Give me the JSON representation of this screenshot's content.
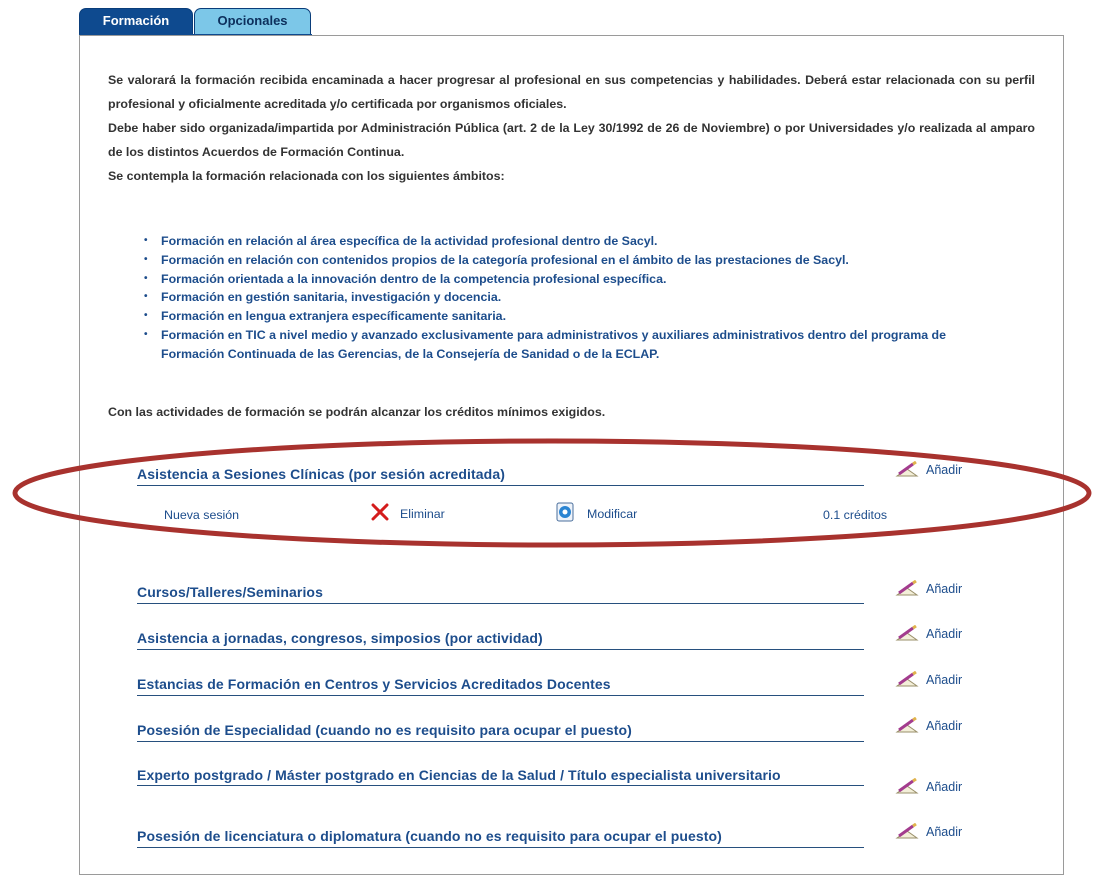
{
  "tabs": [
    {
      "label": "Formación",
      "active": true
    },
    {
      "label": "Opcionales",
      "active": false
    }
  ],
  "intro": {
    "paragraph1": "Se valorará la formación recibida encaminada a hacer progresar al profesional en sus competencias y habilidades. Deberá estar relacionada con su perfil profesional y oficialmente acreditada y/o certificada por organismos oficiales.",
    "paragraph2": "Debe haber sido organizada/impartida por Administración Pública (art. 2 de la Ley 30/1992 de 26 de Noviembre) o por Universidades y/o realizada al amparo de los distintos Acuerdos de Formación Continua.",
    "paragraph3": "Se contempla la formación relacionada con los siguientes ámbitos:"
  },
  "bullets": [
    "Formación en relación al área específica de la actividad profesional dentro de Sacyl.",
    "Formación en relación con contenidos propios de la categoría profesional en el ámbito de las prestaciones de Sacyl.",
    "Formación orientada a la innovación dentro de la competencia profesional específica.",
    "Formación en gestión sanitaria, investigación y docencia.",
    "Formación en lengua extranjera específicamente sanitaria.",
    "Formación en TIC a nivel medio y avanzado exclusivamente para administrativos y auxiliares administrativos dentro del programa de Formación Continuada de las Gerencias, de la Consejería de Sanidad o de la ECLAP."
  ],
  "conclusion": "Con las actividades de formación se podrán alcanzar los créditos mínimos exigidos.",
  "add_label": "Añadir",
  "sections": [
    {
      "title": "Asistencia a Sesiones Clínicas (por sesión acreditada)"
    },
    {
      "title": "Cursos/Talleres/Seminarios"
    },
    {
      "title": "Asistencia a jornadas, congresos, simposios (por actividad)"
    },
    {
      "title": "Estancias de Formación en Centros y Servicios Acreditados Docentes"
    },
    {
      "title": "Posesión de Especialidad (cuando no es requisito para ocupar el puesto)"
    },
    {
      "title": "Experto postgrado / Máster postgrado en Ciencias de la Salud / Título especialista universitario"
    },
    {
      "title": "Posesión de licenciatura o diplomatura (cuando no es requisito para ocupar el puesto)"
    }
  ],
  "session_row": {
    "name": "Nueva sesión",
    "delete_label": "Eliminar",
    "modify_label": "Modificar",
    "credits": "0.1 créditos"
  },
  "colors": {
    "tab_active": "#0e4a8f",
    "tab_inactive": "#7cc7e8",
    "link_blue": "#1d4d8c",
    "highlight_red": "#a8322e",
    "delete_red": "#d41c1c"
  },
  "icons": {
    "add": "pencil-paper-icon",
    "delete": "red-x-icon",
    "modify": "edit-document-icon"
  }
}
